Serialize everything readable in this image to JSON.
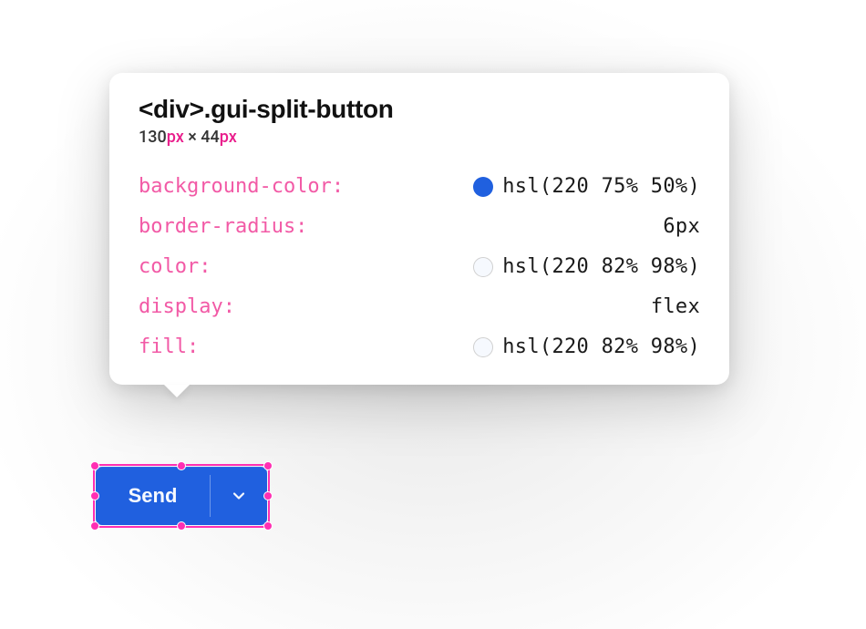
{
  "tooltip": {
    "tag": "<div>",
    "class": ".gui-split-button",
    "width_num": "130",
    "width_unit": "px",
    "times": " × ",
    "height_num": "44",
    "height_unit": "px",
    "props": {
      "bgcolor": {
        "name": "background-color:",
        "value": "hsl(220 75% 50%)",
        "swatch": "hsl(220 75% 50%)"
      },
      "bradius": {
        "name": "border-radius:",
        "value": "6px"
      },
      "color": {
        "name": "color:",
        "value": "hsl(220 82% 98%)",
        "swatch": "hsl(220 82% 98%)"
      },
      "display": {
        "name": "display:",
        "value": "flex"
      },
      "fill": {
        "name": "fill:",
        "value": "hsl(220 82% 98%)",
        "swatch": "hsl(220 82% 98%)"
      }
    }
  },
  "button": {
    "label": "Send"
  },
  "colors": {
    "accent": "hsl(220 75% 50%)",
    "text_on_accent": "hsl(220 82% 98%)",
    "selection_pink": "#ff2fb3"
  }
}
